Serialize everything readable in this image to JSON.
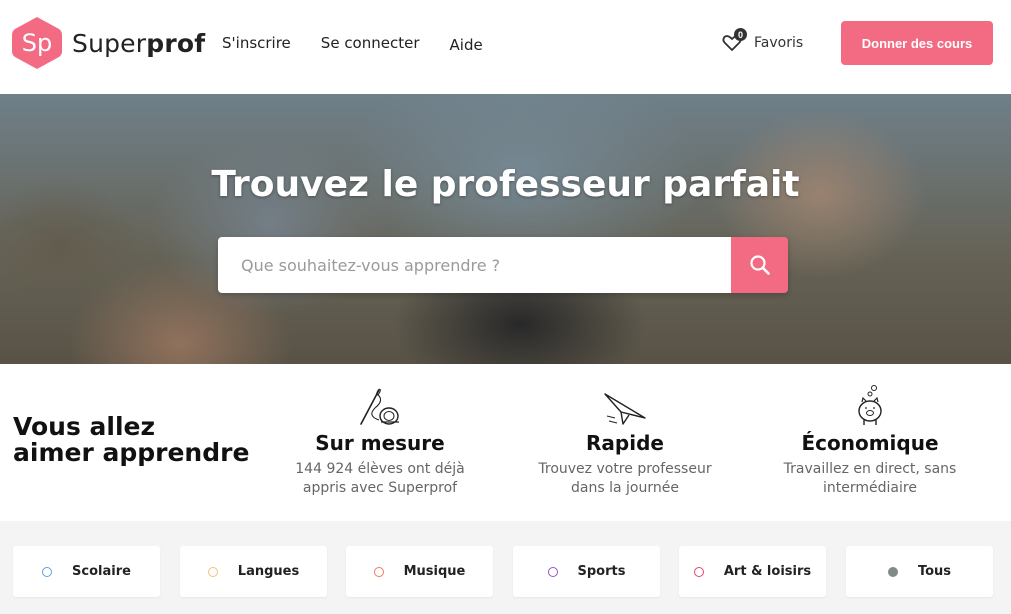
{
  "header": {
    "logo_badge": "Sp",
    "logo_name_regular": "Super",
    "logo_name_bold": "prof",
    "nav": [
      {
        "label": "S'inscrire"
      },
      {
        "label": "Se connecter"
      },
      {
        "label": "Aide"
      }
    ],
    "favorites": {
      "label": "Favoris",
      "count": "0"
    },
    "cta_label": "Donner des cours",
    "brand_color": "#f26b82"
  },
  "hero": {
    "title": "Trouvez le professeur parfait",
    "search_placeholder": "Que souhaitez-vous apprendre ?",
    "search_value": ""
  },
  "features": {
    "title_line1": "Vous allez",
    "title_line2": "aimer apprendre",
    "items": [
      {
        "icon": "needle-thread-icon",
        "title": "Sur mesure",
        "line1": "144 924 élèves ont déjà",
        "line2": "appris avec Superprof"
      },
      {
        "icon": "paper-plane-icon",
        "title": "Rapide",
        "line1": "Trouvez votre professeur",
        "line2": "dans la journée"
      },
      {
        "icon": "piggy-bank-icon",
        "title": "Économique",
        "line1": "Travaillez en direct, sans",
        "line2": "intermédiaire"
      }
    ]
  },
  "categories": [
    {
      "label": "Scolaire",
      "color": "#5aa3e0",
      "filled": false
    },
    {
      "label": "Langues",
      "color": "#f3c27a",
      "filled": false
    },
    {
      "label": "Musique",
      "color": "#ee7b5c",
      "filled": false
    },
    {
      "label": "Sports",
      "color": "#9b4fd0",
      "filled": false
    },
    {
      "label": "Art & loisirs",
      "color": "#e8426d",
      "filled": false
    },
    {
      "label": "Tous",
      "color": "#7e8b86",
      "filled": true
    }
  ]
}
